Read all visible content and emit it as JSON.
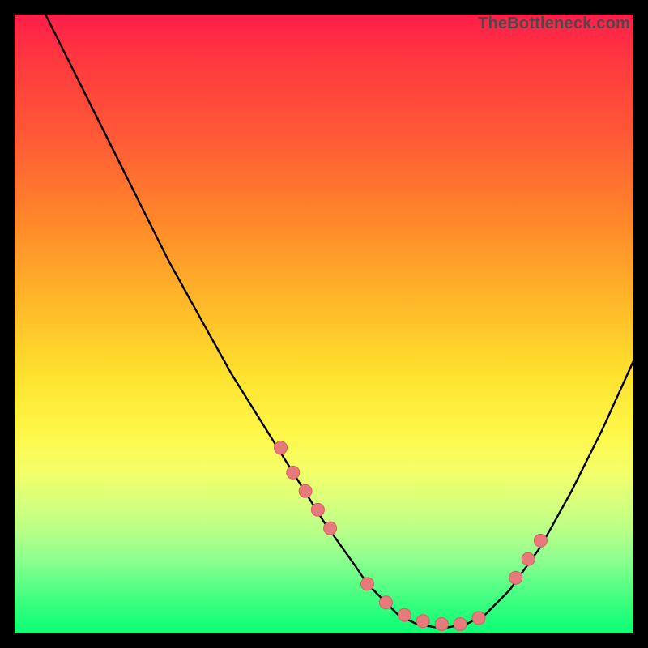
{
  "watermark": "TheBottleneck.com",
  "colors": {
    "curve_stroke": "#000000",
    "marker_fill": "#e77b7b",
    "marker_stroke": "#d55f5f",
    "background_black": "#000000"
  },
  "chart_data": {
    "type": "line",
    "title": "",
    "xlabel": "",
    "ylabel": "",
    "xlim": [
      0,
      100
    ],
    "ylim": [
      0,
      100
    ],
    "note": "No axis tick labels or numeric values are rendered in the image; curve values are estimated from pixel positions on a 0–100 normalized scale.",
    "series": [
      {
        "name": "bottleneck-curve",
        "x": [
          5,
          10,
          15,
          20,
          25,
          30,
          35,
          40,
          45,
          50,
          55,
          57,
          60,
          62,
          65,
          68,
          70,
          73,
          76,
          80,
          85,
          90,
          95,
          100
        ],
        "y": [
          100,
          90,
          80,
          70,
          60,
          51,
          42,
          34,
          26,
          18,
          11,
          8,
          5,
          3,
          1.5,
          1,
          1,
          1.5,
          3,
          7,
          14,
          23,
          33,
          44
        ]
      }
    ],
    "markers": {
      "name": "highlighted-points",
      "x": [
        43,
        45,
        47,
        49,
        51,
        57,
        60,
        63,
        66,
        69,
        72,
        75,
        81,
        83,
        85
      ],
      "y": [
        30,
        26,
        23,
        20,
        17,
        8,
        5,
        3,
        2,
        1.5,
        1.5,
        2.5,
        9,
        12,
        15
      ]
    }
  }
}
